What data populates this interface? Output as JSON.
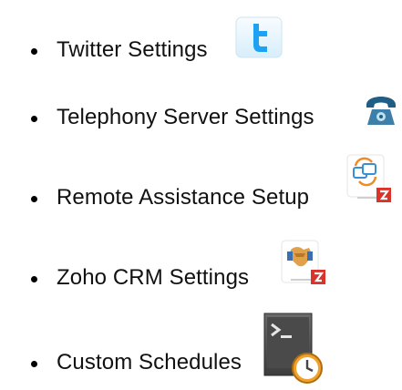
{
  "settings_list": {
    "items": [
      {
        "label": "Twitter Settings",
        "icon": "twitter-icon"
      },
      {
        "label": "Telephony Server Settings",
        "icon": "telephone-icon"
      },
      {
        "label": "Remote Assistance Setup",
        "icon": "remote-assistance-zoho-icon"
      },
      {
        "label": "Zoho CRM Settings",
        "icon": "zoho-crm-handshake-icon"
      },
      {
        "label": "Custom Schedules",
        "icon": "terminal-clock-icon"
      }
    ]
  },
  "colors": {
    "twitter_blue": "#1da1f2",
    "phone_teal": "#1f5f86",
    "zoho_red": "#d9342b",
    "clock_orange": "#f0a12a"
  }
}
